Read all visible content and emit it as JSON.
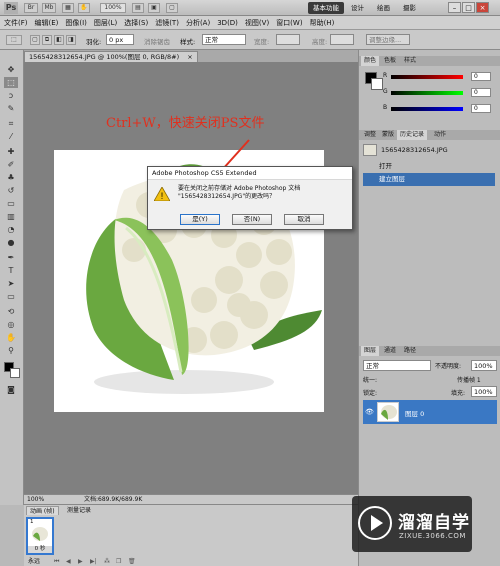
{
  "titlebar": {
    "app_logo": "Ps",
    "zoom": "100%",
    "workspaces": [
      "基本功能",
      "设计",
      "绘画",
      "摄影"
    ],
    "active_workspace": "基本功能",
    "window_controls": [
      "minimize-icon",
      "restore-icon",
      "close-icon"
    ]
  },
  "menu": [
    "文件(F)",
    "编辑(E)",
    "图像(I)",
    "图层(L)",
    "选择(S)",
    "滤镜(T)",
    "分析(A)",
    "3D(D)",
    "视图(V)",
    "窗口(W)",
    "帮助(H)"
  ],
  "options": {
    "feather_label": "羽化:",
    "feather_value": "0 px",
    "antialias": "消除锯齿",
    "style_label": "样式:",
    "style_value": "正常",
    "width_label": "宽度:",
    "height_label": "高度:",
    "refine_edge": "调整边缘..."
  },
  "document_tab": {
    "title": "1565428312654.JPG @ 100%(图层 0, RGB/8#)",
    "close": "×"
  },
  "annotation": "Ctrl+W，快速关闭PS文件",
  "dialog": {
    "title": "Adobe Photoshop CS5 Extended",
    "message_line1": "要在关闭之前存储对 Adobe Photoshop 文档",
    "message_line2": "\"1565428312654.JPG\"的更改吗？",
    "yes": "是(Y)",
    "no": "否(N)",
    "cancel": "取消"
  },
  "status": {
    "zoom": "100%",
    "doc_info": "文档:689.9K/689.9K"
  },
  "animation": {
    "tabs": [
      "动画 (帧)",
      "测量记录"
    ],
    "frame_number": "1",
    "frame_delay": "0 秒",
    "loop": "永远"
  },
  "color_panel": {
    "tabs": [
      "颜色",
      "色板",
      "样式"
    ],
    "r_label": "R",
    "g_label": "G",
    "b_label": "B",
    "r": "0",
    "g": "0",
    "b": "0"
  },
  "history_panel": {
    "tabs": [
      "调整",
      "蒙版",
      "历史记录",
      "动作"
    ],
    "snapshot": "1565428312654.JPG",
    "steps": [
      "打开",
      "建立图层"
    ],
    "selected_step": "建立图层"
  },
  "layers_panel": {
    "tabs": [
      "图层",
      "通道",
      "路径"
    ],
    "blend_mode": "正常",
    "opacity_label": "不透明度:",
    "opacity": "100%",
    "lock_label": "锁定:",
    "unify_label": "统一:",
    "propagate": "传播帧 1",
    "fill_label": "填充:",
    "fill": "100%",
    "layer_name": "图层 0"
  },
  "watermark": {
    "brand": "溜溜自学",
    "url": "ZIXUE.3066.COM"
  },
  "colors": {
    "accent": "#3a78c4",
    "annotation": "#e0301e"
  }
}
